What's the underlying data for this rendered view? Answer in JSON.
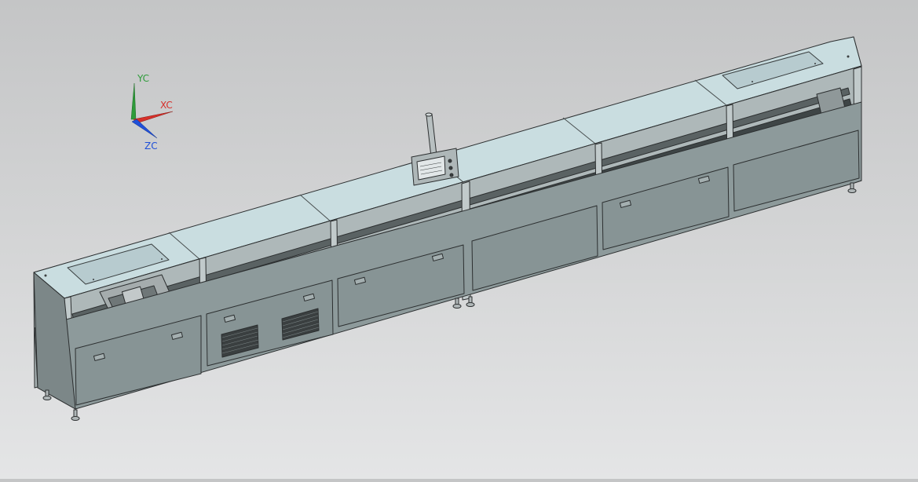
{
  "triad": {
    "y_label": "YC",
    "x_label": "XC",
    "z_label": "ZC",
    "y_color": "#2e9b3a",
    "x_color": "#d6302a",
    "z_color": "#2050d8"
  },
  "colors": {
    "body": "#8d9a9b",
    "body_dark": "#7c8788",
    "top_panel": "#c9dde0",
    "frame": "#b9c2c3",
    "outline": "#2c2f30"
  },
  "icons": {
    "triad": "coordinate-triad-icon",
    "pendant": "control-pendant-icon"
  }
}
